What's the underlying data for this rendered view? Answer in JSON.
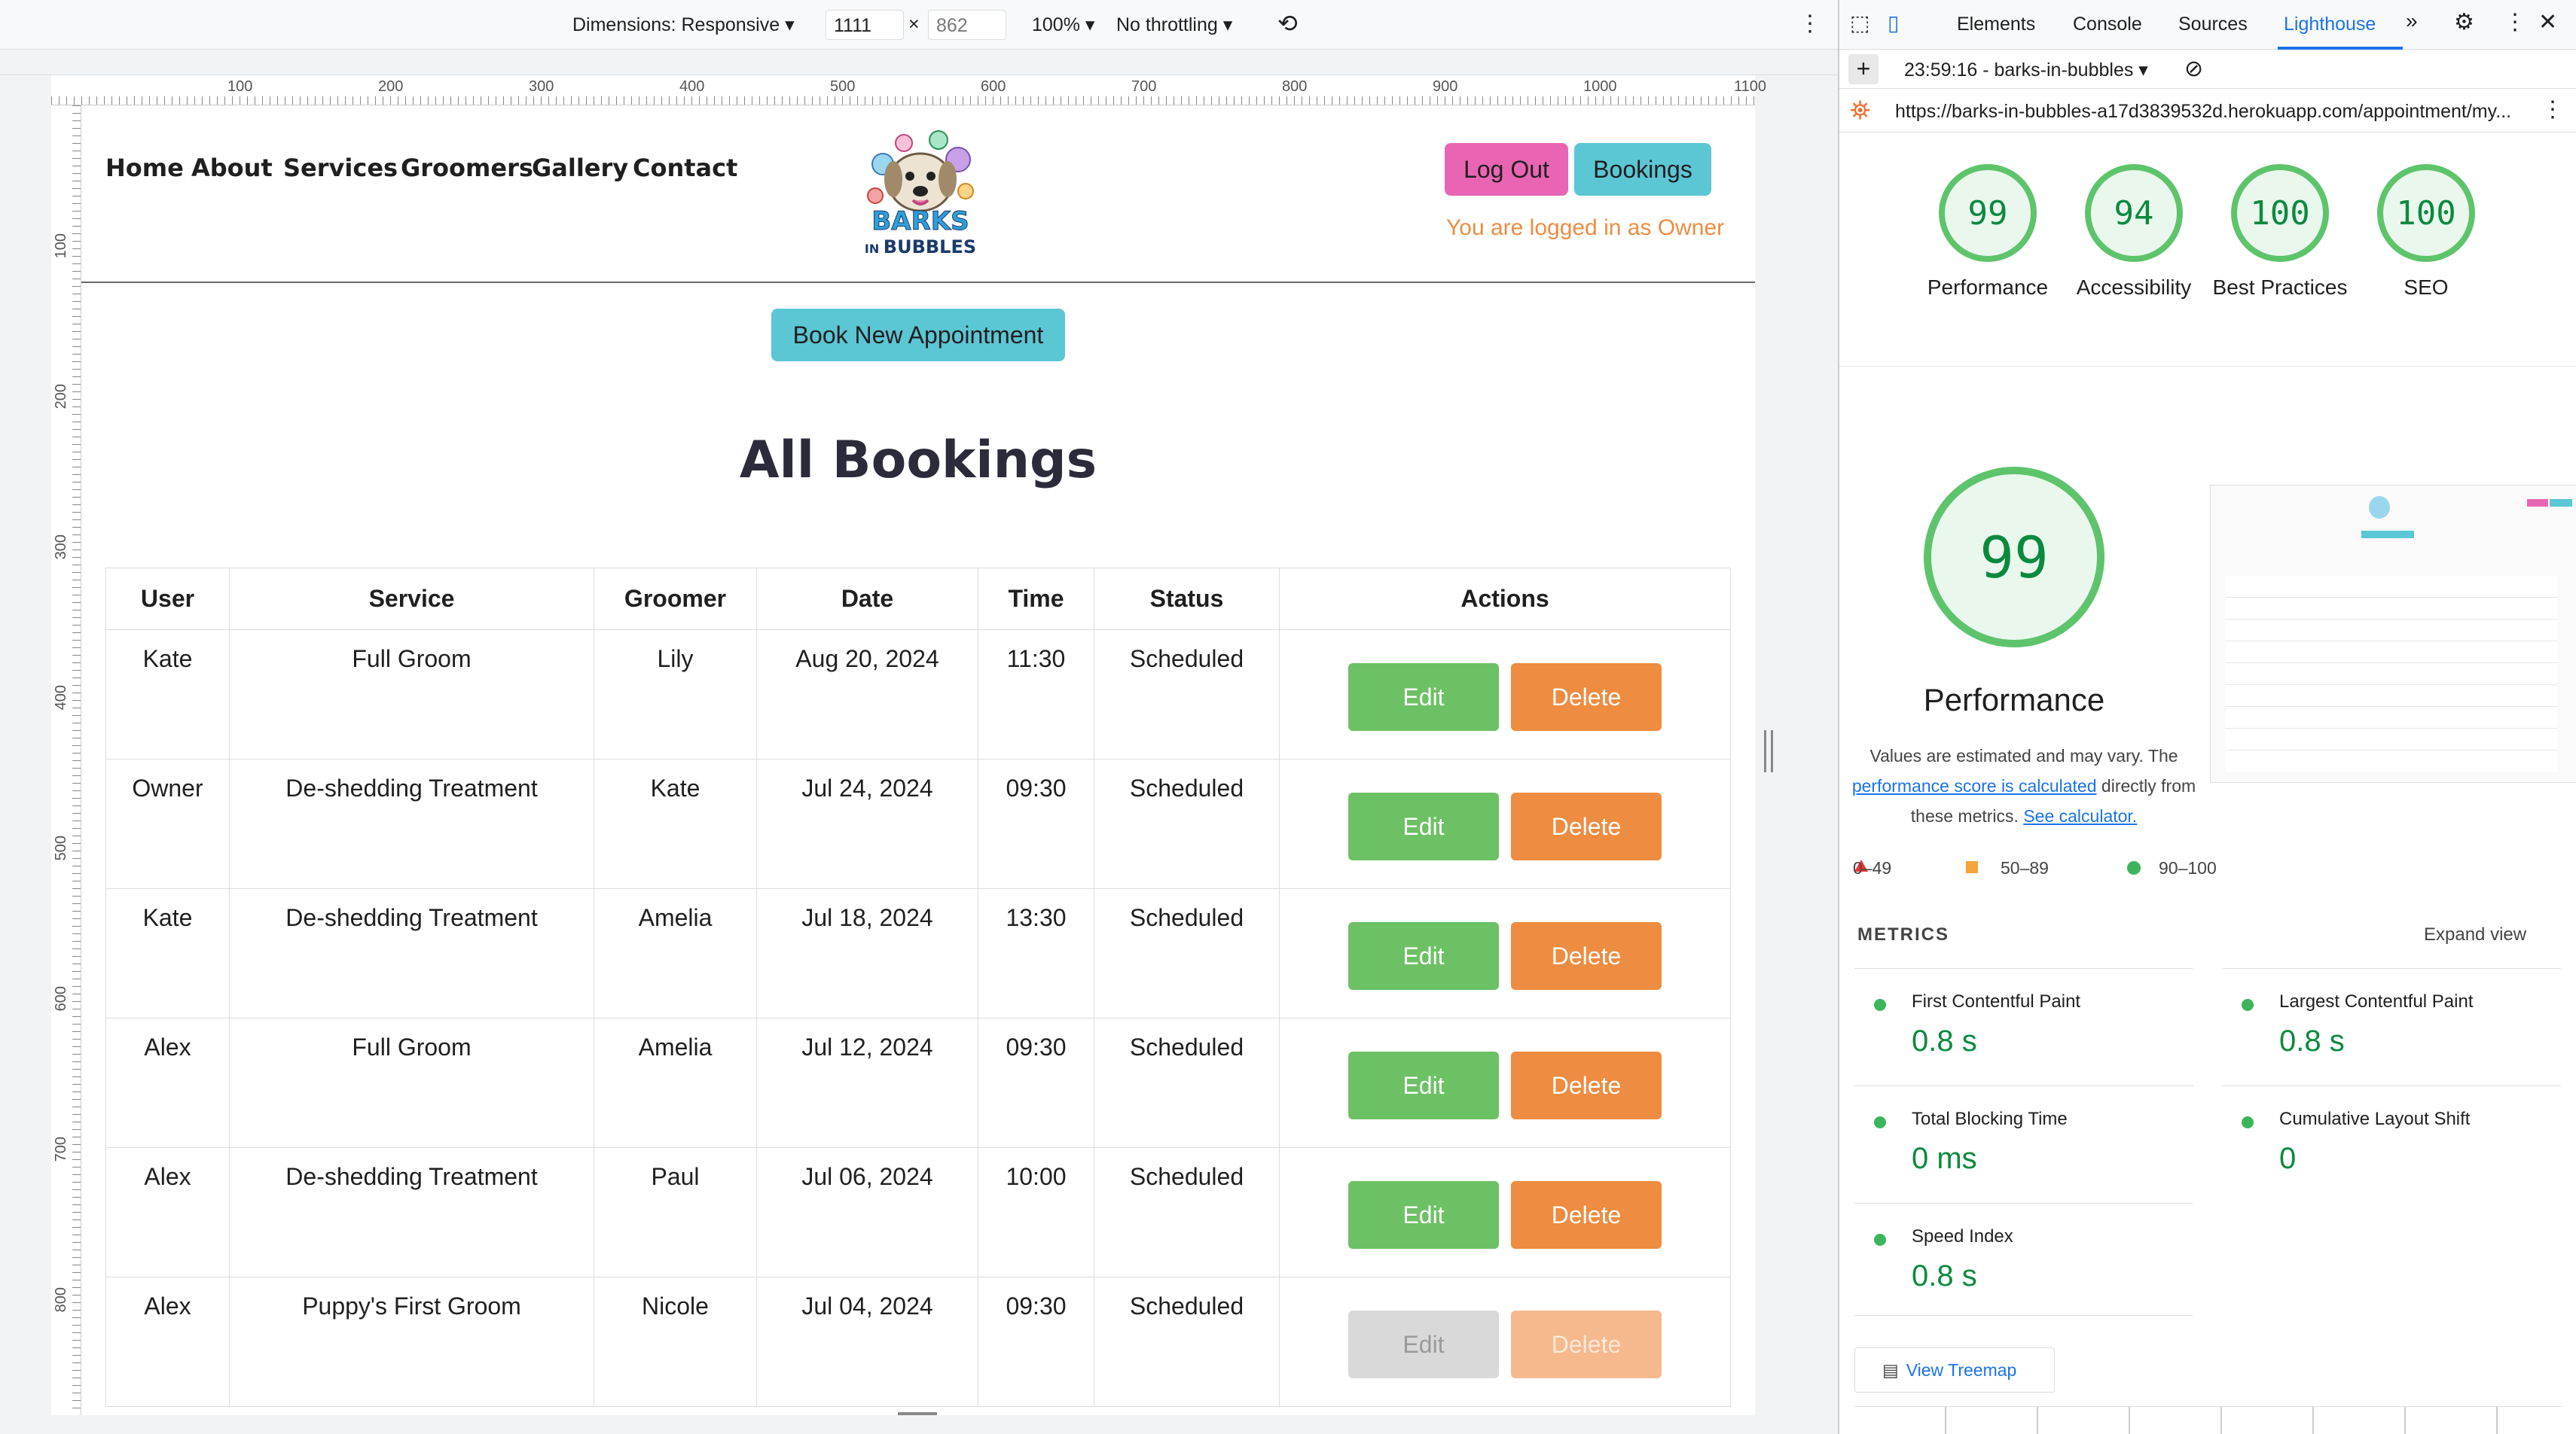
{
  "devicebar": {
    "dimensions": "Dimensions: Responsive",
    "width": "1111",
    "height": "862",
    "zoom": "100%",
    "throttling": "No throttling"
  },
  "ruler": {
    "h": [
      "100",
      "200",
      "300",
      "400",
      "500",
      "600",
      "700",
      "800",
      "900",
      "1000",
      "1100"
    ],
    "v": [
      "100",
      "200",
      "300",
      "400",
      "500",
      "600",
      "700",
      "800"
    ]
  },
  "site": {
    "nav": [
      "Home",
      "About",
      "Services",
      "Groomers",
      "Gallery",
      "Contact"
    ],
    "logo_top": "BARKS",
    "logo_small": "IN",
    "logo_bottom": "BUBBLES",
    "logout": "Log Out",
    "bookings": "Bookings",
    "logged_in": "You are logged in as Owner",
    "new_appt": "Book New Appointment",
    "heading": "All Bookings"
  },
  "table": {
    "headers": [
      "User",
      "Service",
      "Groomer",
      "Date",
      "Time",
      "Status",
      "Actions"
    ],
    "rows": [
      {
        "user": "Kate",
        "service": "Full Groom",
        "groomer": "Lily",
        "date": "Aug 20, 2024",
        "time": "11:30",
        "status": "Scheduled",
        "edit": "Edit",
        "delete": "Delete",
        "disabled": false
      },
      {
        "user": "Owner",
        "service": "De-shedding Treatment",
        "groomer": "Kate",
        "date": "Jul 24, 2024",
        "time": "09:30",
        "status": "Scheduled",
        "edit": "Edit",
        "delete": "Delete",
        "disabled": false
      },
      {
        "user": "Kate",
        "service": "De-shedding Treatment",
        "groomer": "Amelia",
        "date": "Jul 18, 2024",
        "time": "13:30",
        "status": "Scheduled",
        "edit": "Edit",
        "delete": "Delete",
        "disabled": false
      },
      {
        "user": "Alex",
        "service": "Full Groom",
        "groomer": "Amelia",
        "date": "Jul 12, 2024",
        "time": "09:30",
        "status": "Scheduled",
        "edit": "Edit",
        "delete": "Delete",
        "disabled": false
      },
      {
        "user": "Alex",
        "service": "De-shedding Treatment",
        "groomer": "Paul",
        "date": "Jul 06, 2024",
        "time": "10:00",
        "status": "Scheduled",
        "edit": "Edit",
        "delete": "Delete",
        "disabled": false
      },
      {
        "user": "Alex",
        "service": "Puppy's First Groom",
        "groomer": "Nicole",
        "date": "Jul 04, 2024",
        "time": "09:30",
        "status": "Scheduled",
        "edit": "Edit",
        "delete": "Delete",
        "disabled": true
      }
    ]
  },
  "devtools": {
    "tabs": [
      "Elements",
      "Console",
      "Sources",
      "Lighthouse"
    ],
    "active_tab": "Lighthouse",
    "report": "23:59:16 - barks-in-bubbles",
    "url": "https://barks-in-bubbles-a17d3839532d.herokuapp.com/appointment/my...",
    "scores": [
      {
        "value": "99",
        "label": "Performance"
      },
      {
        "value": "94",
        "label": "Accessibility"
      },
      {
        "value": "100",
        "label": "Best Practices"
      },
      {
        "value": "100",
        "label": "SEO"
      }
    ],
    "big_score": "99",
    "big_label": "Performance",
    "note_1": "Values are estimated and may vary. The ",
    "note_link": "performance score is calculated",
    "note_2": " directly from these metrics. ",
    "note_link2": "See calculator.",
    "legend": [
      "0–49",
      "50–89",
      "90–100"
    ],
    "metrics_title": "METRICS",
    "expand": "Expand view",
    "metrics": [
      {
        "label": "First Contentful Paint",
        "value": "0.8 s"
      },
      {
        "label": "Largest Contentful Paint",
        "value": "0.8 s"
      },
      {
        "label": "Total Blocking Time",
        "value": "0 ms"
      },
      {
        "label": "Cumulative Layout Shift",
        "value": "0"
      },
      {
        "label": "Speed Index",
        "value": "0.8 s"
      }
    ],
    "treemap": "View Treemap"
  },
  "colors": {
    "pink": "#e965b3",
    "teal": "#5bc6d4",
    "green": "#6cc164",
    "orange": "#ee8c41",
    "lh_green": "#5ec46b"
  }
}
